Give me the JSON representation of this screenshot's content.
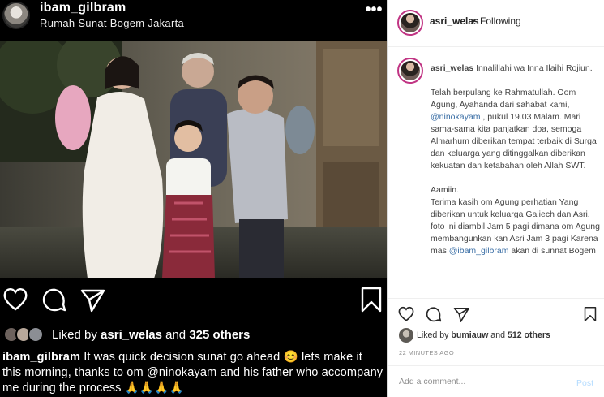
{
  "left_post": {
    "username": "ibam_gilbram",
    "location": "Rumah Sunat Bogem Jakarta",
    "more_icon": "more-dots",
    "actions": {
      "like_icon": "heart-outline",
      "comment_icon": "comment-bubble",
      "share_icon": "paper-plane",
      "save_icon": "bookmark"
    },
    "liked_by": {
      "prefix": "Liked by",
      "user": "asri_welas",
      "mid": "and",
      "count": "325 others"
    },
    "caption": {
      "user": "ibam_gilbram",
      "text": "It was quick decision sunat go ahead 😊 lets make it this morning,  thanks to om @ninokayam and his father who accompany me during the process 🙏🙏🙏🙏"
    }
  },
  "right_panel": {
    "header": {
      "username": "asri_welas",
      "separator": "•",
      "status": "Following"
    },
    "caption": {
      "user": "asri_welas",
      "p1": "Innalillahi wa Inna Ilaihi Rojiun.",
      "p2_a": "Telah berpulang ke Rahmatullah. Oom Agung, Ayahanda dari sahabat kami, ",
      "p2_mention": "@ninokayam",
      "p2_b": " , pukul 19.03 Malam. Mari sama-sama kita panjatkan doa, semoga Almarhum diberikan tempat terbaik di Surga dan keluarga yang ditinggalkan diberikan kekuatan dan ketabahan oleh Allah SWT.",
      "p3_a": "Aamiin.\nTerima kasih om Agung perhatian Yang diberikan untuk keluarga Galiech dan Asri. foto ini diambil Jam 5 pagi dimana om Agung membangunkan kan Asri Jam 3 pagi Karena mas ",
      "p3_mention": "@ibam_gilbram",
      "p3_b": " akan di sunnat Bogem"
    },
    "actions": {
      "like_icon": "heart-outline",
      "comment_icon": "comment-bubble",
      "share_icon": "paper-plane",
      "save_icon": "bookmark"
    },
    "liked_by": {
      "prefix": "Liked by",
      "user": "bumiauw",
      "mid": "and",
      "count": "512 others"
    },
    "timestamp": "22 MINUTES AGO",
    "comment": {
      "placeholder": "Add a comment...",
      "post_label": "Post"
    }
  },
  "colors": {
    "left_bg": "#000000",
    "right_bg": "#ffffff",
    "mention": "#3a6ea5",
    "post_disabled": "#b3dbff",
    "muted": "#8e8e8e"
  }
}
